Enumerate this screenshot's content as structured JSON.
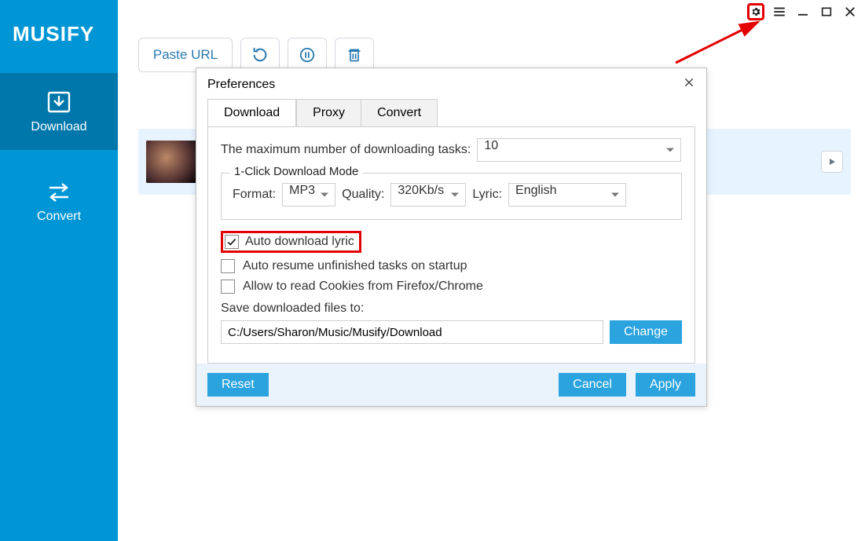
{
  "app": {
    "logo": "MUSIFY"
  },
  "sidebar": {
    "items": [
      {
        "label": "Download",
        "icon": "download-icon",
        "active": true
      },
      {
        "label": "Convert",
        "icon": "convert-icon",
        "active": false
      }
    ]
  },
  "toolbar": {
    "paste_label": "Paste URL",
    "icons": [
      "retry-icon",
      "pause-icon",
      "trash-icon"
    ]
  },
  "dialog": {
    "title": "Preferences",
    "tabs": [
      "Download",
      "Proxy",
      "Convert"
    ],
    "active_tab": "Download",
    "max_label": "The maximum number of downloading tasks:",
    "max_value": "10",
    "mode_legend": "1-Click Download Mode",
    "format_label": "Format:",
    "format_value": "MP3",
    "quality_label": "Quality:",
    "quality_value": "320Kb/s",
    "lyric_label": "Lyric:",
    "lyric_value": "English",
    "chk_auto_lyric": "Auto download lyric",
    "chk_auto_resume": "Auto resume unfinished tasks on startup",
    "chk_cookies": "Allow to read Cookies from Firefox/Chrome",
    "save_label": "Save downloaded files to:",
    "save_path": "C:/Users/Sharon/Music/Musify/Download",
    "change": "Change",
    "reset": "Reset",
    "cancel": "Cancel",
    "apply": "Apply"
  }
}
